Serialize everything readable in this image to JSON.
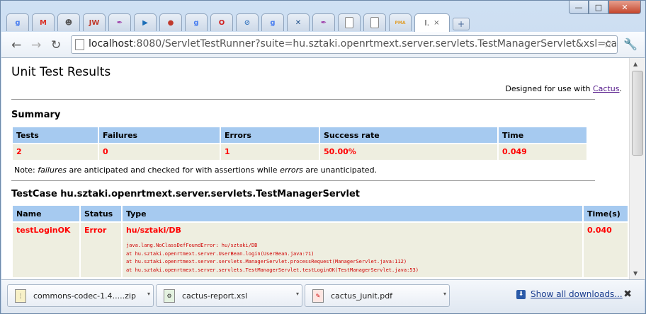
{
  "browser": {
    "tabs": [
      {
        "icon": "google-icon",
        "glyph": "g",
        "color": "#4a7ff0"
      },
      {
        "icon": "gmail-icon",
        "glyph": "M",
        "color": "#d93025"
      },
      {
        "icon": "gnome-icon",
        "glyph": "☻",
        "color": "#555555"
      },
      {
        "icon": "jw-icon",
        "glyph": "JW",
        "color": "#c0392b"
      },
      {
        "icon": "feather-icon",
        "glyph": "✒",
        "color": "#9b3aa8"
      },
      {
        "icon": "media-icon",
        "glyph": "▶",
        "color": "#1d6fb8"
      },
      {
        "icon": "disc-icon",
        "glyph": "●",
        "color": "#c0392b"
      },
      {
        "icon": "google-icon",
        "glyph": "g",
        "color": "#4a7ff0"
      },
      {
        "icon": "oracle-icon",
        "glyph": "O",
        "color": "#d02020"
      },
      {
        "icon": "paperclip-icon",
        "glyph": "⊘",
        "color": "#3a78c0"
      },
      {
        "icon": "google-icon",
        "glyph": "g",
        "color": "#4a7ff0"
      },
      {
        "icon": "puzzle-icon",
        "glyph": "✕",
        "color": "#1d4f8a"
      },
      {
        "icon": "feather-icon",
        "glyph": "✒",
        "color": "#9b3aa8"
      },
      {
        "icon": "page-icon",
        "glyph": "",
        "color": "#ffffff"
      },
      {
        "icon": "page-icon",
        "glyph": "",
        "color": "#ffffff"
      },
      {
        "icon": "pma-icon",
        "glyph": "PMA",
        "color": "#e0a030"
      }
    ],
    "active_tab": {
      "title": "I.",
      "close": "×"
    },
    "new_tab": "+",
    "url_host": "localhost",
    "url_rest": ":8080/ServletTestRunner?suite=hu.sztaki.openrtmext.server.servlets.TestManagerServlet&xsl=cactus-r",
    "window_controls": {
      "minimize": "—",
      "maximize": "□",
      "close": "✕"
    }
  },
  "page": {
    "title": "Unit Test Results",
    "designed_prefix": "Designed for use with ",
    "designed_link": "Cactus",
    "designed_suffix": ".",
    "summary_heading": "Summary",
    "summary_headers": [
      "Tests",
      "Failures",
      "Errors",
      "Success rate",
      "Time"
    ],
    "summary_values": [
      "2",
      "0",
      "1",
      "50.00%",
      "0.049"
    ],
    "note_parts": [
      "Note: ",
      "failures",
      " are anticipated and checked for with assertions while ",
      "errors",
      " are unanticipated."
    ],
    "testcase_heading": "TestCase hu.sztaki.openrtmext.server.servlets.TestManagerServlet",
    "testcase_headers": [
      "Name",
      "Status",
      "Type",
      "Time(s)"
    ],
    "testcase_row": {
      "name": "testLoginOK",
      "status": "Error",
      "type": "hu/sztaki/DB",
      "time": "0.040",
      "trace": [
        "java.lang.NoClassDefFoundError: hu/sztaki/DB",
        "at hu.sztaki.openrtmext.server.UserBean.login(UserBean.java:71)",
        "at hu.sztaki.openrtmext.server.servlets.ManagerServlet.processRequest(ManagerServlet.java:112)",
        "at hu.sztaki.openrtmext.server.servlets.TestManagerServlet.testLoginOK(TestManagerServlet.java:53)"
      ]
    }
  },
  "downloads": {
    "items": [
      {
        "name": "commons-codec-1.4.....zip",
        "icon": "zip-icon"
      },
      {
        "name": "cactus-report.xsl",
        "icon": "xsl-icon"
      },
      {
        "name": "cactus_junit.pdf",
        "icon": "pdf-icon"
      }
    ],
    "show_all": "Show all downloads...",
    "close": "✖"
  }
}
